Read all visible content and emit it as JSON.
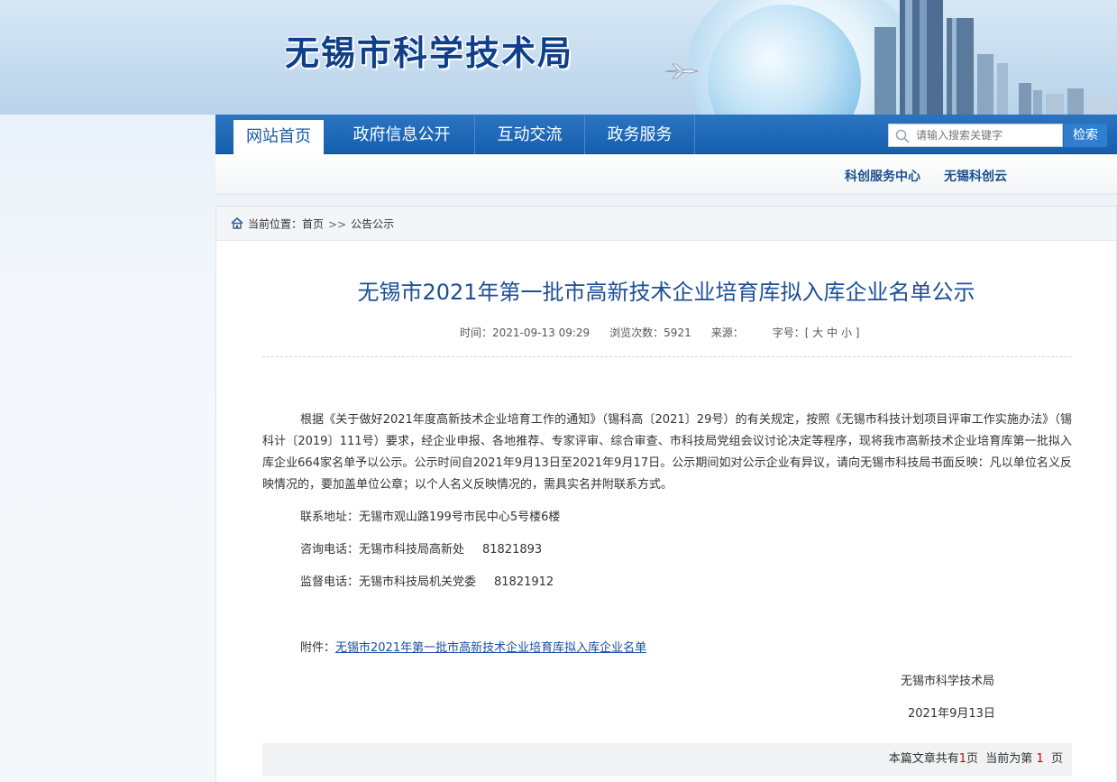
{
  "header": {
    "site_title": "无锡市科学技术局"
  },
  "nav": {
    "items": [
      {
        "label": "网站首页",
        "active": true
      },
      {
        "label": "政府信息公开",
        "active": false
      },
      {
        "label": "互动交流",
        "active": false
      },
      {
        "label": "政务服务",
        "active": false
      }
    ],
    "search": {
      "placeholder": "请输入搜索关键字",
      "button_label": "检索"
    }
  },
  "sub_links": [
    "科创服务中心",
    "无锡科创云"
  ],
  "breadcrumb": {
    "prefix": "当前位置：",
    "items": [
      "首页",
      "公告公示"
    ],
    "separator": ">>"
  },
  "article": {
    "title": "无锡市2021年第一批市高新技术企业培育库拟入库企业名单公示",
    "meta": {
      "time_label": "时间：",
      "time": "2021-09-13 09:29",
      "views_label": "浏览次数：",
      "views": "5921",
      "source_label": "来源：",
      "font_label": "字号：",
      "font_open": "[",
      "font_large": "大",
      "font_medium": "中",
      "font_small": "小",
      "font_close": "]"
    },
    "paragraph": "根据《关于做好2021年度高新技术企业培育工作的通知》（锡科高〔2021〕29号）的有关规定，按照《无锡市科技计划项目评审工作实施办法》（锡科计〔2019〕111号）要求，经企业申报、各地推荐、专家评审、综合审查、市科技局党组会议讨论决定等程序，现将我市高新技术企业培育库第一批拟入库企业664家名单予以公示。公示时间自2021年9月13日至2021年9月17日。公示期间如对公示企业有异议，请向无锡市科技局书面反映：凡以单位名义反映情况的，要加盖单位公章；以个人名义反映情况的，需具实名并附联系方式。",
    "address": "联系地址：无锡市观山路199号市民中心5号楼6楼",
    "consult_label": "咨询电话：无锡市科技局高新处",
    "consult_number": "81821893",
    "supervise_label": "监督电话：无锡市科技局机关党委",
    "supervise_number": "81821912",
    "attachment_label": "附件：",
    "attachment_link": "无锡市2021年第一批市高新技术企业培育库拟入库企业名单",
    "sign_org": "无锡市科学技术局",
    "sign_date": "2021年9月13日"
  },
  "pager": {
    "text_a": "本篇文章共有",
    "total": "1",
    "text_b": "页  当前为第",
    "current": "1",
    "text_c": "页"
  },
  "colors": {
    "nav_blue": "#155fae",
    "title_blue": "#1d4f95",
    "pager_red": "#cc0000"
  }
}
